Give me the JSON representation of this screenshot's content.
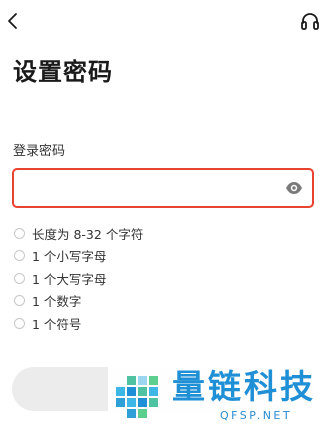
{
  "header": {
    "back_icon": "chevron-left-icon",
    "support_icon": "headset-icon"
  },
  "title": "设置密码",
  "password": {
    "label": "登录密码",
    "value": "",
    "placeholder": "",
    "error_border_color": "#e8432f",
    "visibility_icon": "eye-icon"
  },
  "requirements": [
    {
      "text": "长度为 8-32 个字符",
      "met": false
    },
    {
      "text": "1 个小写字母",
      "met": false
    },
    {
      "text": "1 个大写字母",
      "met": false
    },
    {
      "text": "1 个数字",
      "met": false
    },
    {
      "text": "1 个符号",
      "met": false
    }
  ],
  "submit": {
    "label": "",
    "background": "#ececec"
  },
  "watermark": {
    "name": "量链科技",
    "domain": "QFSP.NET",
    "color": "#1f8fd6"
  }
}
